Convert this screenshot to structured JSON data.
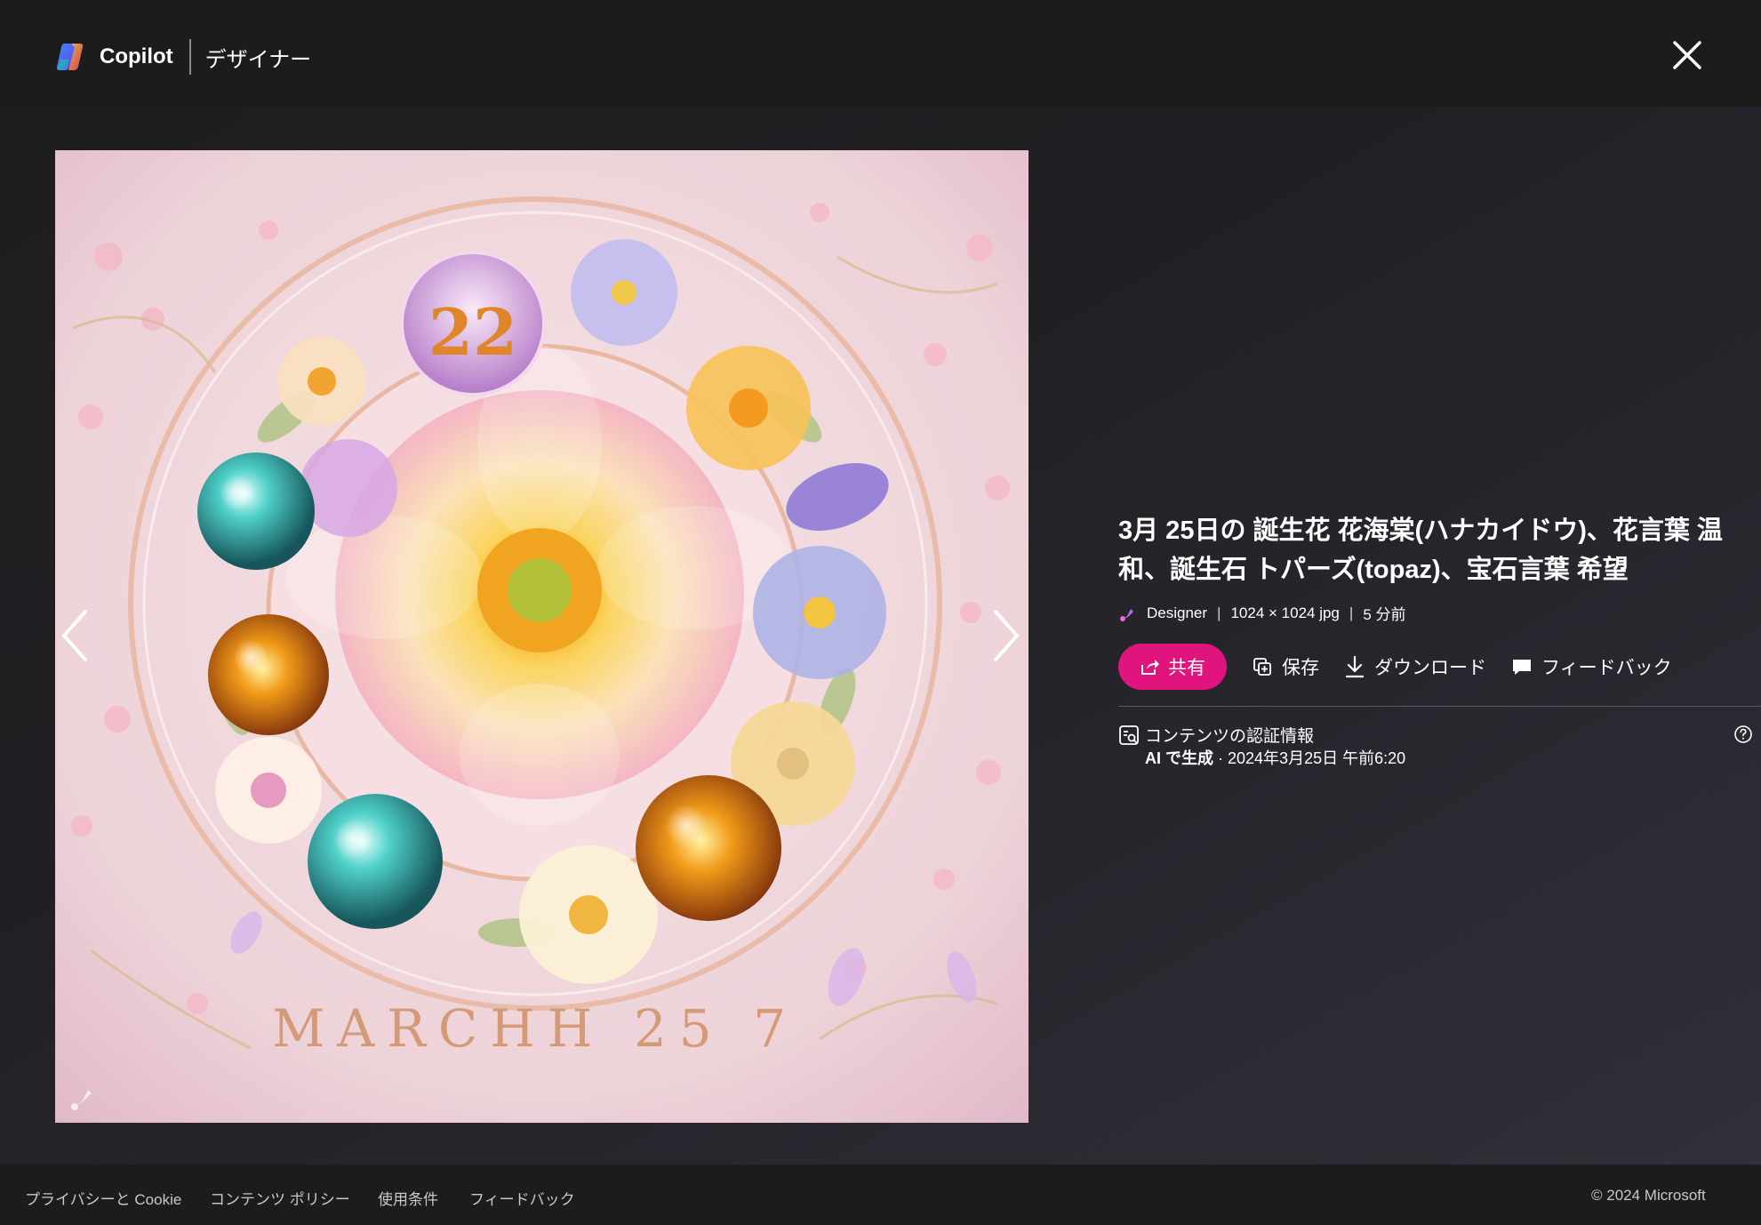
{
  "header": {
    "app_name": "Copilot",
    "section": "デザイナー",
    "close_icon": "close-icon"
  },
  "image": {
    "caption_text": "MARCHH 25 7",
    "badge_number": "22",
    "prev_icon": "chevron-left-icon",
    "next_icon": "chevron-right-icon"
  },
  "details": {
    "title": "3月 25日の 誕生花 花海棠(ハナカイドウ)、花言葉 温和、誕生石 トパーズ(topaz)、宝石言葉 希望",
    "meta": {
      "creator": "Designer",
      "dimensions": "1024 × 1024 jpg",
      "time": "5 分前",
      "separator": "|"
    },
    "actions": {
      "share": "共有",
      "save": "保存",
      "download": "ダウンロード",
      "feedback": "フィードバック"
    },
    "credentials": {
      "title": "コンテンツの認証情報",
      "generated_label": "AI で生成",
      "timestamp": " · 2024年3月25日 午前6:20"
    }
  },
  "footer": {
    "privacy": "プライバシーと Cookie",
    "content_policy": "コンテンツ ポリシー",
    "terms": "使用条件",
    "feedback": "フィードバック",
    "copyright": "© 2024 Microsoft"
  },
  "colors": {
    "accent": "#e0147d",
    "background": "#1c1c1c"
  }
}
